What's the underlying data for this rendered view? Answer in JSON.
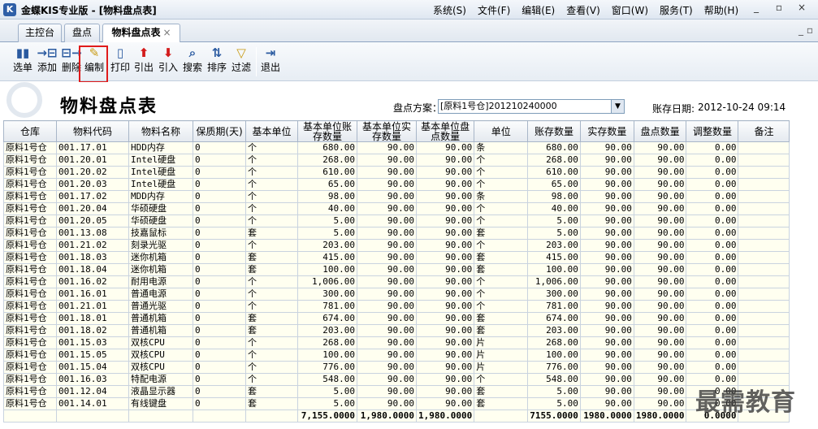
{
  "window": {
    "title": "金蝶KIS专业版 - [物料盘点表]",
    "menu": [
      "系统(S)",
      "文件(F)",
      "编辑(E)",
      "查看(V)",
      "窗口(W)",
      "服务(T)",
      "帮助(H)"
    ],
    "controls": [
      "_",
      "▫",
      "×"
    ]
  },
  "tabs": [
    {
      "label": "主控台"
    },
    {
      "label": "盘点"
    },
    {
      "label": "物料盘点表",
      "close": "×"
    }
  ],
  "tab_controls": "_ ▫",
  "toolbar": {
    "select": {
      "label": "选单",
      "icon": "book-icon"
    },
    "add": {
      "label": "添加",
      "icon": "arrow-in-icon"
    },
    "delete": {
      "label": "删除",
      "icon": "arrow-out-icon"
    },
    "edit": {
      "label": "编制",
      "icon": "edit-icon"
    },
    "print": {
      "label": "打印",
      "icon": "print-icon"
    },
    "export": {
      "label": "引出",
      "icon": "export-icon"
    },
    "import": {
      "label": "引入",
      "icon": "import-icon"
    },
    "search": {
      "label": "搜索",
      "icon": "search-icon"
    },
    "sort": {
      "label": "排序",
      "icon": "sort-icon"
    },
    "filter": {
      "label": "过滤",
      "icon": "filter-icon"
    },
    "exit": {
      "label": "退出",
      "icon": "exit-icon"
    }
  },
  "header": {
    "title": "物料盘点表",
    "scheme_label": "盘点方案：",
    "scheme_value": "[原料1号仓]201210240000",
    "date_label": "账存日期:",
    "date_value": "2012-10-24 09:14"
  },
  "table": {
    "columns": [
      "仓库",
      "物料代码",
      "物料名称",
      "保质期(天)",
      "基本单位",
      "基本单位账存数量",
      "基本单位实存数量",
      "基本单位盘点数量",
      "单位",
      "账存数量",
      "实存数量",
      "盘点数量",
      "调整数量",
      "备注"
    ],
    "rows": [
      [
        "原料1号仓",
        "001.17.01",
        "HDD内存",
        "0",
        "个",
        "680.00",
        "90.00",
        "90.00",
        "条",
        "680.00",
        "90.00",
        "90.00",
        "0.00",
        ""
      ],
      [
        "原料1号仓",
        "001.20.01",
        "Intel硬盘",
        "0",
        "个",
        "268.00",
        "90.00",
        "90.00",
        "个",
        "268.00",
        "90.00",
        "90.00",
        "0.00",
        ""
      ],
      [
        "原料1号仓",
        "001.20.02",
        "Intel硬盘",
        "0",
        "个",
        "610.00",
        "90.00",
        "90.00",
        "个",
        "610.00",
        "90.00",
        "90.00",
        "0.00",
        ""
      ],
      [
        "原料1号仓",
        "001.20.03",
        "Intel硬盘",
        "0",
        "个",
        "65.00",
        "90.00",
        "90.00",
        "个",
        "65.00",
        "90.00",
        "90.00",
        "0.00",
        ""
      ],
      [
        "原料1号仓",
        "001.17.02",
        "MDD内存",
        "0",
        "个",
        "98.00",
        "90.00",
        "90.00",
        "条",
        "98.00",
        "90.00",
        "90.00",
        "0.00",
        ""
      ],
      [
        "原料1号仓",
        "001.20.04",
        "华硕硬盘",
        "0",
        "个",
        "40.00",
        "90.00",
        "90.00",
        "个",
        "40.00",
        "90.00",
        "90.00",
        "0.00",
        ""
      ],
      [
        "原料1号仓",
        "001.20.05",
        "华硕硬盘",
        "0",
        "个",
        "5.00",
        "90.00",
        "90.00",
        "个",
        "5.00",
        "90.00",
        "90.00",
        "0.00",
        ""
      ],
      [
        "原料1号仓",
        "001.13.08",
        "技嘉鼠标",
        "0",
        "套",
        "5.00",
        "90.00",
        "90.00",
        "套",
        "5.00",
        "90.00",
        "90.00",
        "0.00",
        ""
      ],
      [
        "原料1号仓",
        "001.21.02",
        "刻录光驱",
        "0",
        "个",
        "203.00",
        "90.00",
        "90.00",
        "个",
        "203.00",
        "90.00",
        "90.00",
        "0.00",
        ""
      ],
      [
        "原料1号仓",
        "001.18.03",
        "迷你机箱",
        "0",
        "套",
        "415.00",
        "90.00",
        "90.00",
        "套",
        "415.00",
        "90.00",
        "90.00",
        "0.00",
        ""
      ],
      [
        "原料1号仓",
        "001.18.04",
        "迷你机箱",
        "0",
        "套",
        "100.00",
        "90.00",
        "90.00",
        "套",
        "100.00",
        "90.00",
        "90.00",
        "0.00",
        ""
      ],
      [
        "原料1号仓",
        "001.16.02",
        "耐用电源",
        "0",
        "个",
        "1,006.00",
        "90.00",
        "90.00",
        "个",
        "1,006.00",
        "90.00",
        "90.00",
        "0.00",
        ""
      ],
      [
        "原料1号仓",
        "001.16.01",
        "普通电源",
        "0",
        "个",
        "300.00",
        "90.00",
        "90.00",
        "个",
        "300.00",
        "90.00",
        "90.00",
        "0.00",
        ""
      ],
      [
        "原料1号仓",
        "001.21.01",
        "普通光驱",
        "0",
        "个",
        "781.00",
        "90.00",
        "90.00",
        "个",
        "781.00",
        "90.00",
        "90.00",
        "0.00",
        ""
      ],
      [
        "原料1号仓",
        "001.18.01",
        "普通机箱",
        "0",
        "套",
        "674.00",
        "90.00",
        "90.00",
        "套",
        "674.00",
        "90.00",
        "90.00",
        "0.00",
        ""
      ],
      [
        "原料1号仓",
        "001.18.02",
        "普通机箱",
        "0",
        "套",
        "203.00",
        "90.00",
        "90.00",
        "套",
        "203.00",
        "90.00",
        "90.00",
        "0.00",
        ""
      ],
      [
        "原料1号仓",
        "001.15.03",
        "双核CPU",
        "0",
        "个",
        "268.00",
        "90.00",
        "90.00",
        "片",
        "268.00",
        "90.00",
        "90.00",
        "0.00",
        ""
      ],
      [
        "原料1号仓",
        "001.15.05",
        "双核CPU",
        "0",
        "个",
        "100.00",
        "90.00",
        "90.00",
        "片",
        "100.00",
        "90.00",
        "90.00",
        "0.00",
        ""
      ],
      [
        "原料1号仓",
        "001.15.04",
        "双核CPU",
        "0",
        "个",
        "776.00",
        "90.00",
        "90.00",
        "片",
        "776.00",
        "90.00",
        "90.00",
        "0.00",
        ""
      ],
      [
        "原料1号仓",
        "001.16.03",
        "特配电源",
        "0",
        "个",
        "548.00",
        "90.00",
        "90.00",
        "个",
        "548.00",
        "90.00",
        "90.00",
        "0.00",
        ""
      ],
      [
        "原料1号仓",
        "001.12.04",
        "液晶显示器",
        "0",
        "套",
        "5.00",
        "90.00",
        "90.00",
        "套",
        "5.00",
        "90.00",
        "90.00",
        "0.00",
        ""
      ],
      [
        "原料1号仓",
        "001.14.01",
        "有线键盘",
        "0",
        "套",
        "5.00",
        "90.00",
        "90.00",
        "套",
        "5.00",
        "90.00",
        "90.00",
        "0.00",
        ""
      ]
    ],
    "totals": [
      "",
      "",
      "",
      "",
      "",
      "7,155.0000",
      "1,980.0000",
      "1,980.0000",
      "",
      "7155.0000",
      "1980.0000",
      "1980.0000",
      "0.0000",
      ""
    ]
  },
  "watermark": "最需教育",
  "colors": {
    "highlight": "#e01b1b",
    "cell_bg": "#fffff0"
  }
}
